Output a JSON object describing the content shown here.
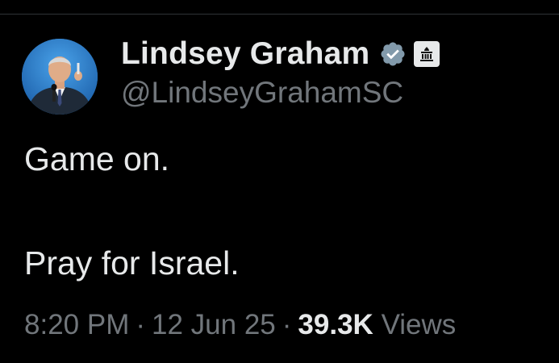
{
  "theme": {
    "background": "#000000",
    "text_primary": "#e7e9ea",
    "text_secondary": "#71767b",
    "verified_color": "#829aab"
  },
  "author": {
    "display_name": "Lindsey Graham",
    "handle": "@LindseyGrahamSC",
    "avatar_icon": "avatar-photo",
    "verified_icon": "verified-badge-icon",
    "affiliation_icon": "government-building-icon"
  },
  "tweet": {
    "lines": [
      "Game on.",
      "Pray for Israel."
    ]
  },
  "meta": {
    "time": "8:20 PM",
    "separator": "·",
    "date": "12 Jun 25",
    "views_count": "39.3K",
    "views_label": "Views"
  }
}
